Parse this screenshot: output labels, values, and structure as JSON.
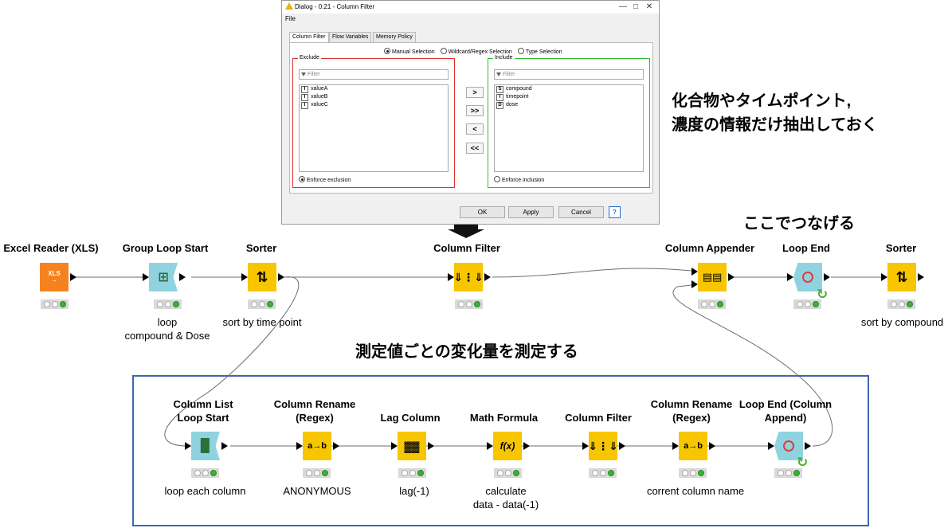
{
  "dialog": {
    "title": "Dialog - 0:21 - Column Filter",
    "menu": "File",
    "tabs": [
      "Column Filter",
      "Flow Variables",
      "Memory Policy"
    ],
    "modes": [
      "Manual Selection",
      "Wildcard/Regex Selection",
      "Type Selection"
    ],
    "exclude": {
      "legend": "Exclude",
      "filter_placeholder": "Filter",
      "items": [
        {
          "type": "I",
          "name": "valueA"
        },
        {
          "type": "I",
          "name": "valueB"
        },
        {
          "type": "I",
          "name": "valueC"
        }
      ],
      "enforce": "Enforce exclusion"
    },
    "include": {
      "legend": "Include",
      "filter_placeholder": "Filter",
      "items": [
        {
          "type": "S",
          "name": "compound"
        },
        {
          "type": "I",
          "name": "timepoint"
        },
        {
          "type": "D",
          "name": "dose"
        }
      ],
      "enforce": "Enforce inclusion"
    },
    "move_buttons": [
      ">",
      ">>",
      "<",
      "<<"
    ],
    "buttons": {
      "ok": "OK",
      "apply": "Apply",
      "cancel": "Cancel",
      "help": "?"
    }
  },
  "annotations": {
    "extract_note_line1": "化合物やタイムポイント,",
    "extract_note_line2": "濃度の情報だけ抽出しておく",
    "join_note": "ここでつなげる",
    "loop_note": "測定値ごとの変化量を測定する"
  },
  "workflow": {
    "top": [
      {
        "title": "Excel Reader (XLS)",
        "label": ""
      },
      {
        "title": "Group Loop Start",
        "label": "loop\ncompound & Dose"
      },
      {
        "title": "Sorter",
        "label": "sort by time point"
      },
      {
        "title": "Column Filter",
        "label": ""
      },
      {
        "title": "Column Appender",
        "label": ""
      },
      {
        "title": "Loop End",
        "label": ""
      },
      {
        "title": "Sorter",
        "label": "sort by compound"
      }
    ],
    "inner": [
      {
        "title": "Column List\nLoop Start",
        "label": "loop each column"
      },
      {
        "title": "Column Rename\n(Regex)",
        "label": "ANONYMOUS"
      },
      {
        "title": "Lag Column",
        "label": "lag(-1)"
      },
      {
        "title": "Math Formula",
        "label": "calculate\ndata - data(-1)"
      },
      {
        "title": "Column Filter",
        "label": ""
      },
      {
        "title": "Column Rename\n(Regex)",
        "label": "corrent column name"
      },
      {
        "title": "Loop End (Column\nAppend)",
        "label": ""
      }
    ]
  },
  "colors": {
    "reader": "#f5821f",
    "loop": "#8fd3e0",
    "manipulator": "#f7c600",
    "frame": "#3d67b0",
    "exclude_border": "#e03030",
    "include_border": "#33bb33"
  }
}
